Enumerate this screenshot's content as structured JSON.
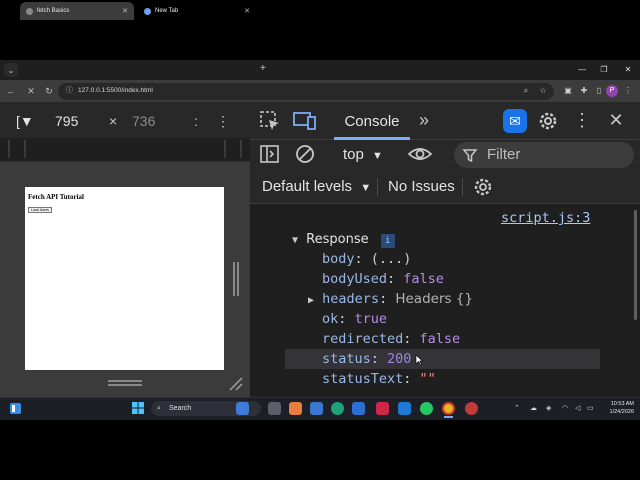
{
  "browser": {
    "tabs": [
      {
        "title": "fetch Basics",
        "active": true
      },
      {
        "title": "New Tab",
        "active": false
      }
    ],
    "url": "127.0.0.1:5500/index.html",
    "profile_initial": "P"
  },
  "device_toolbar": {
    "width": "795",
    "separator": "×",
    "height": "736"
  },
  "page": {
    "heading": "Fetch API Tutorial",
    "button_label": "Load Users"
  },
  "devtools": {
    "active_tab": "Console",
    "context": "top",
    "filter_placeholder": "Filter",
    "levels": "Default levels",
    "issues": "No Issues",
    "source_link": "script.js:3",
    "object_label": "Response",
    "info_badge": "i",
    "properties": [
      {
        "key": "body",
        "value": "(...)",
        "kind": "plain"
      },
      {
        "key": "bodyUsed",
        "value": "false",
        "kind": "kw"
      },
      {
        "key": "headers",
        "value": "Headers {}",
        "kind": "obj"
      },
      {
        "key": "ok",
        "value": "true",
        "kind": "kw"
      },
      {
        "key": "redirected",
        "value": "false",
        "kind": "kw"
      },
      {
        "key": "status",
        "value": "200",
        "kind": "num"
      },
      {
        "key": "statusText",
        "value": "\"\"",
        "kind": "str"
      }
    ]
  },
  "taskbar": {
    "search_label": "Search",
    "time": "10:53 AM",
    "date": "1/24/2026"
  }
}
